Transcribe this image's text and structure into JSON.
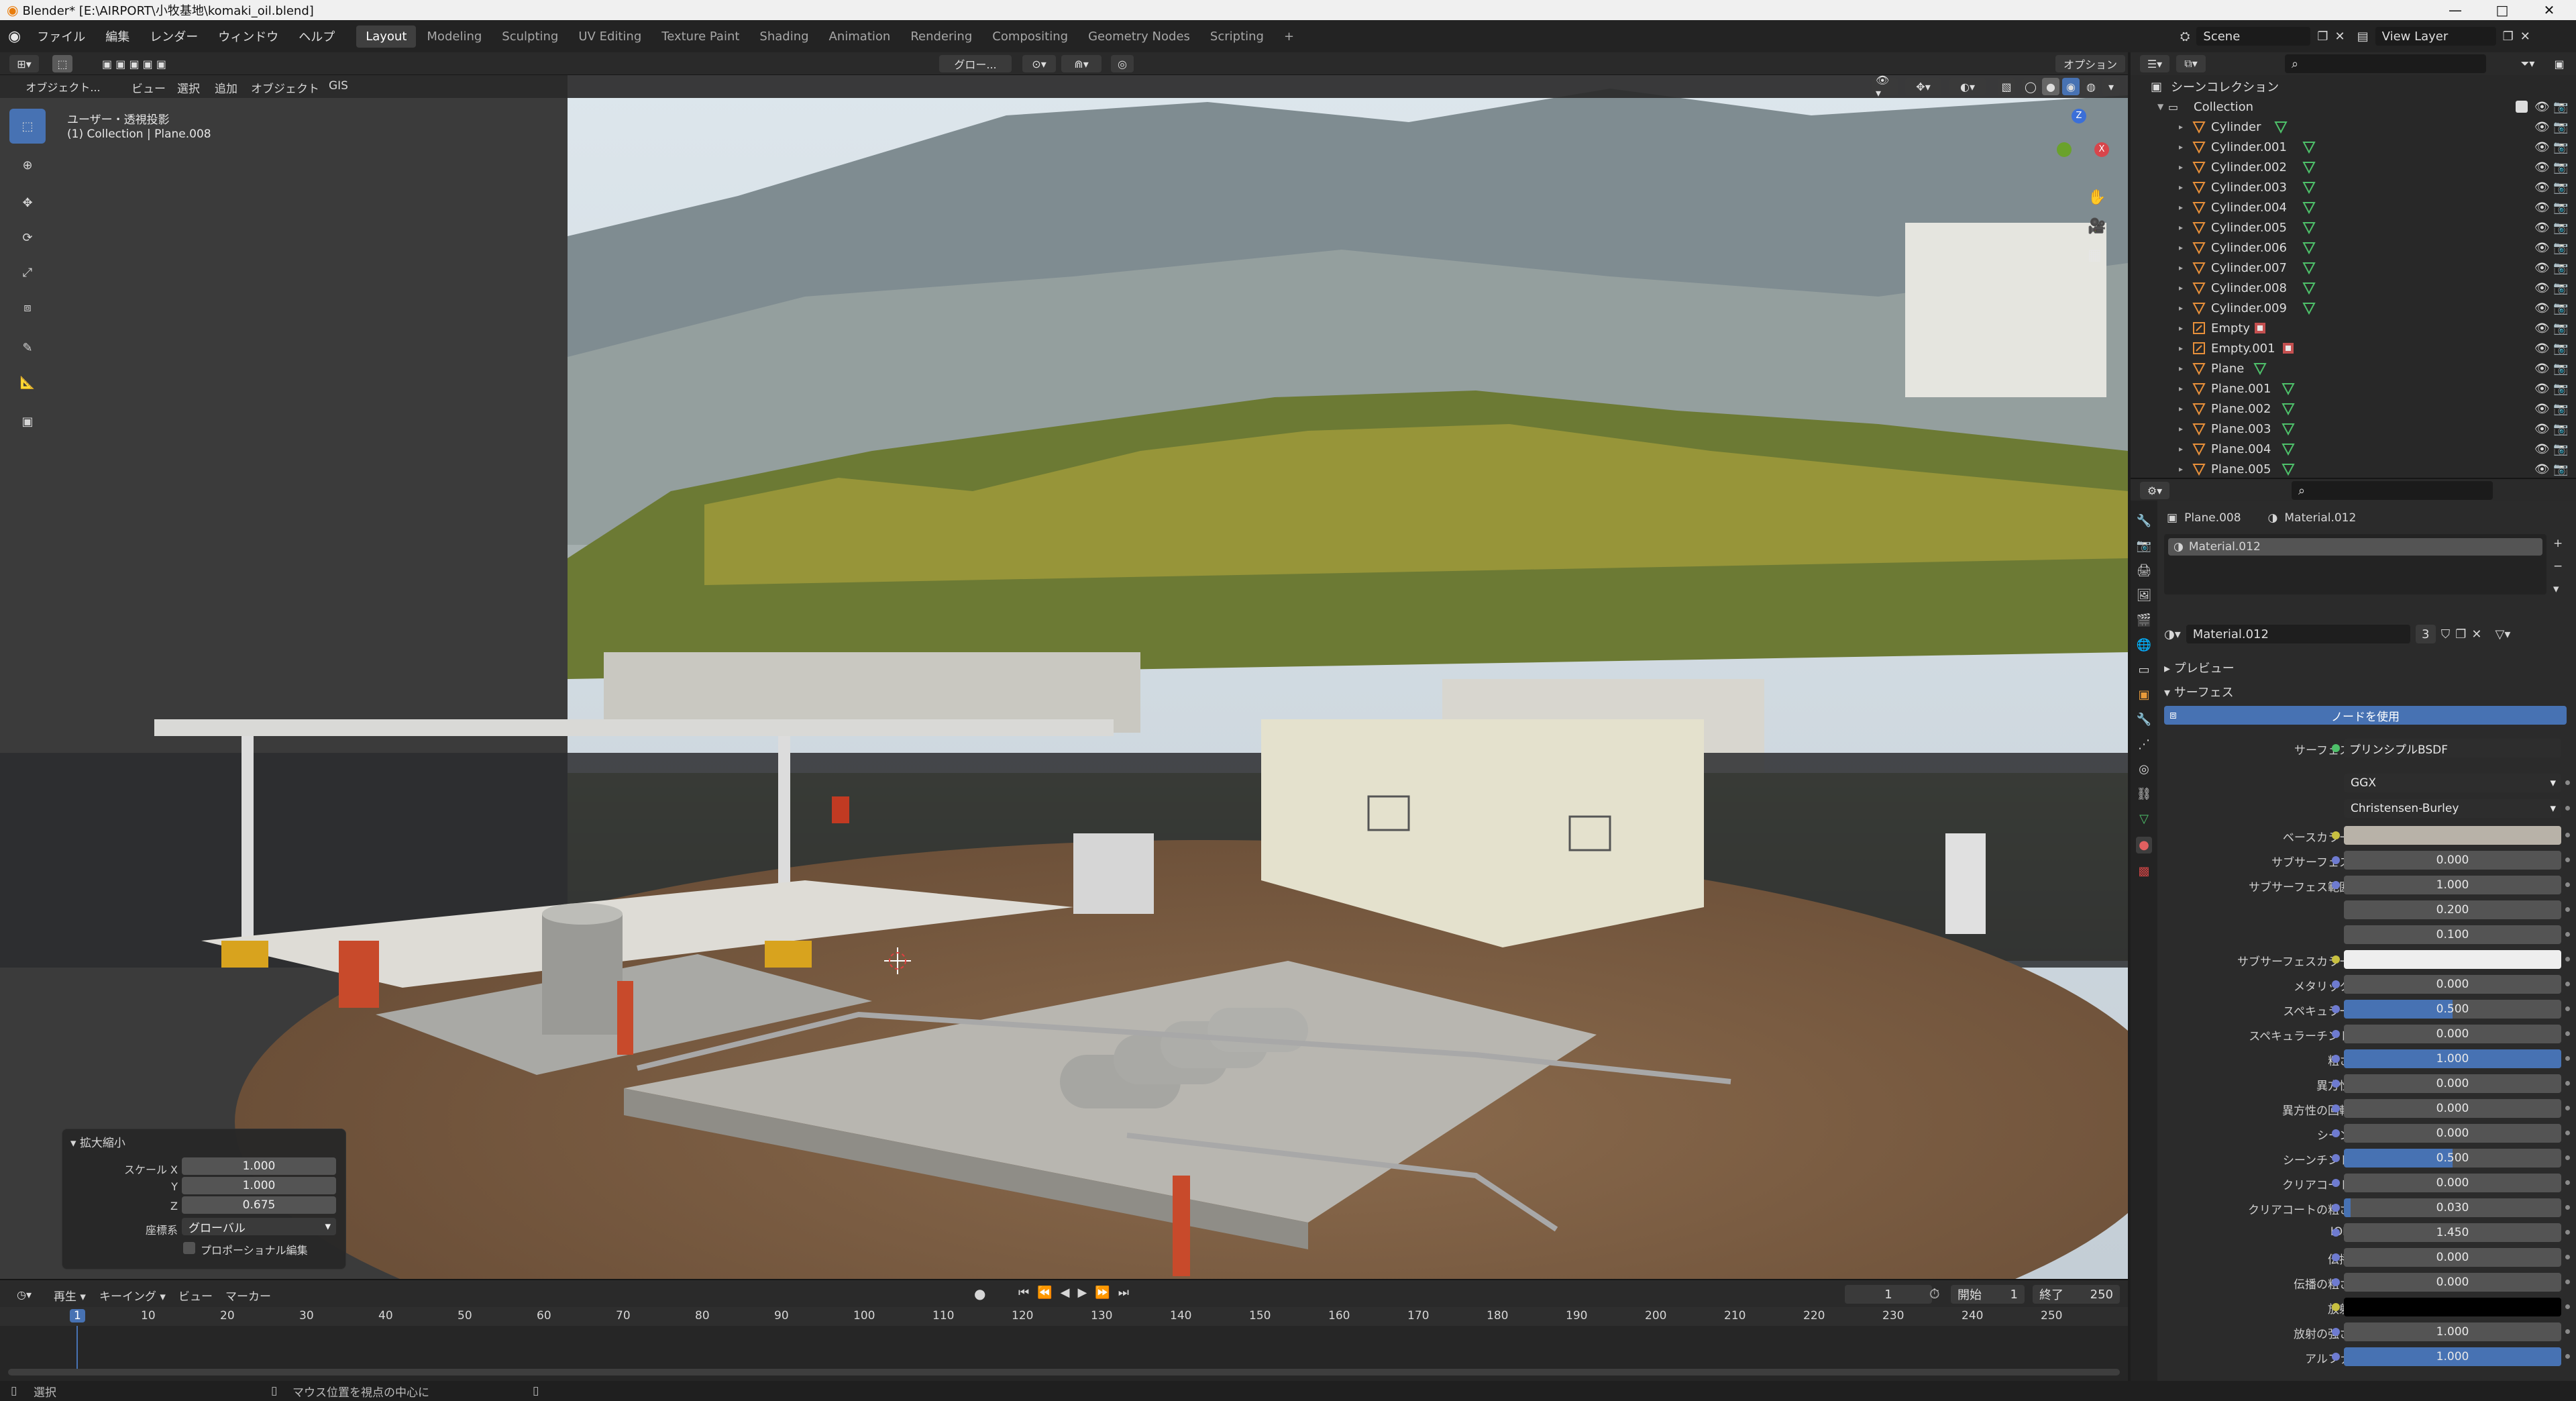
{
  "title_bar": {
    "title": "Blender* [E:\\AIRPORT\\小牧基地\\komaki_oil.blend]",
    "minimize": "—",
    "maximize": "□",
    "close": "✕"
  },
  "menus": [
    "ファイル",
    "編集",
    "レンダー",
    "ウィンドウ",
    "ヘルプ"
  ],
  "workspace_tabs": [
    "Layout",
    "Modeling",
    "Sculpting",
    "UV Editing",
    "Texture Paint",
    "Shading",
    "Animation",
    "Rendering",
    "Compositing",
    "Geometry Nodes",
    "Scripting"
  ],
  "active_workspace": "Layout",
  "scene": {
    "label": "Scene",
    "view_layer": "View Layer"
  },
  "viewport": {
    "mode": "オブジェクト...",
    "menus": [
      "ビュー",
      "選択",
      "追加",
      "オブジェクト",
      "GIS"
    ],
    "orientation": "グロー...",
    "options": "オプション",
    "view_name": "ユーザー・透視投影",
    "collection_info": "(1) Collection | Plane.008",
    "gizmo": {
      "x": "X",
      "y": "Y",
      "z": "Z"
    }
  },
  "scale_panel": {
    "title": "拡大縮小",
    "label_scale_x": "スケール X",
    "label_y": "Y",
    "label_z": "Z",
    "scale_x": "1.000",
    "scale_y": "1.000",
    "scale_z": "0.675",
    "orientation_label": "座標系",
    "orientation_value": "グローバル",
    "proportional_label": "プロポーショナル編集"
  },
  "outliner": {
    "title": "シーンコレクション",
    "collection": "Collection",
    "items": [
      {
        "name": "Cylinder",
        "type": "mesh"
      },
      {
        "name": "Cylinder.001",
        "type": "mesh"
      },
      {
        "name": "Cylinder.002",
        "type": "mesh"
      },
      {
        "name": "Cylinder.003",
        "type": "mesh"
      },
      {
        "name": "Cylinder.004",
        "type": "mesh"
      },
      {
        "name": "Cylinder.005",
        "type": "mesh"
      },
      {
        "name": "Cylinder.006",
        "type": "mesh"
      },
      {
        "name": "Cylinder.007",
        "type": "mesh"
      },
      {
        "name": "Cylinder.008",
        "type": "mesh"
      },
      {
        "name": "Cylinder.009",
        "type": "mesh"
      },
      {
        "name": "Empty",
        "type": "empty"
      },
      {
        "name": "Empty.001",
        "type": "empty"
      },
      {
        "name": "Plane",
        "type": "mesh"
      },
      {
        "name": "Plane.001",
        "type": "mesh"
      },
      {
        "name": "Plane.002",
        "type": "mesh"
      },
      {
        "name": "Plane.003",
        "type": "mesh"
      },
      {
        "name": "Plane.004",
        "type": "mesh"
      },
      {
        "name": "Plane.005",
        "type": "mesh"
      }
    ]
  },
  "properties": {
    "object": "Plane.008",
    "material": "Material.012",
    "slot": "Material.012",
    "material_name": "Material.012",
    "users": "3",
    "section_preview": "プレビュー",
    "section_surface": "サーフェス",
    "use_nodes": "ノードを使用",
    "surface_label": "サーフェス",
    "surface_value": "プリンシプルBSDF",
    "distribution": "GGX",
    "subsurface_method": "Christensen-Burley",
    "params": [
      {
        "label": "ベースカラー",
        "kind": "color",
        "color": "#b8b2a8",
        "dot": "#c8c040"
      },
      {
        "label": "サブサーフェス",
        "value": "0.000",
        "fill": 0,
        "dot": "#6e7bd0"
      },
      {
        "label": "サブサーフェス範囲",
        "value": "1.000",
        "fill": 0,
        "dot": "#6e7bd0"
      },
      {
        "label": "",
        "value": "0.200",
        "fill": 0,
        "dot": ""
      },
      {
        "label": "",
        "value": "0.100",
        "fill": 0,
        "dot": ""
      },
      {
        "label": "サブサーフェスカラー",
        "kind": "color",
        "color": "#eeeeee",
        "dot": "#c8c040"
      },
      {
        "label": "メタリック",
        "value": "0.000",
        "fill": 0,
        "dot": "#6e7bd0"
      },
      {
        "label": "スペキュラー",
        "value": "0.500",
        "fill": 0.5,
        "dot": "#6e7bd0"
      },
      {
        "label": "スペキュラーチント",
        "value": "0.000",
        "fill": 0,
        "dot": "#6e7bd0"
      },
      {
        "label": "粗さ",
        "value": "1.000",
        "fill": 1,
        "dot": "#6e7bd0"
      },
      {
        "label": "異方性",
        "value": "0.000",
        "fill": 0,
        "dot": "#6e7bd0"
      },
      {
        "label": "異方性の回転",
        "value": "0.000",
        "fill": 0,
        "dot": "#6e7bd0"
      },
      {
        "label": "シーン",
        "value": "0.000",
        "fill": 0,
        "dot": "#6e7bd0"
      },
      {
        "label": "シーンチント",
        "value": "0.500",
        "fill": 0.5,
        "dot": "#6e7bd0"
      },
      {
        "label": "クリアコート",
        "value": "0.000",
        "fill": 0,
        "dot": "#6e7bd0"
      },
      {
        "label": "クリアコートの粗さ",
        "value": "0.030",
        "fill": 0.03,
        "dot": "#6e7bd0"
      },
      {
        "label": "IOR",
        "value": "1.450",
        "fill": 0,
        "dot": "#6e7bd0"
      },
      {
        "label": "伝播",
        "value": "0.000",
        "fill": 0,
        "dot": "#6e7bd0"
      },
      {
        "label": "伝播の粗さ",
        "value": "0.000",
        "fill": 0,
        "dot": "#6e7bd0"
      },
      {
        "label": "放射",
        "kind": "color",
        "color": "#000000",
        "dot": "#c8c040"
      },
      {
        "label": "放射の強さ",
        "value": "1.000",
        "fill": 0,
        "dot": "#6e7bd0"
      },
      {
        "label": "アルファ",
        "value": "1.000",
        "fill": 1,
        "dot": "#6e7bd0"
      }
    ]
  },
  "timeline": {
    "menus": [
      "再生",
      "キーイング",
      "ビュー",
      "マーカー"
    ],
    "current_frame": "1",
    "start_label": "開始",
    "start": "1",
    "end_label": "終了",
    "end": "250",
    "ticks": [
      "1",
      "10",
      "20",
      "30",
      "40",
      "50",
      "60",
      "70",
      "80",
      "90",
      "100",
      "110",
      "120",
      "130",
      "140",
      "150",
      "160",
      "170",
      "180",
      "190",
      "200",
      "210",
      "220",
      "230",
      "240",
      "250"
    ]
  },
  "status": {
    "select": "選択",
    "center": "マウス位置を視点の中心に"
  }
}
